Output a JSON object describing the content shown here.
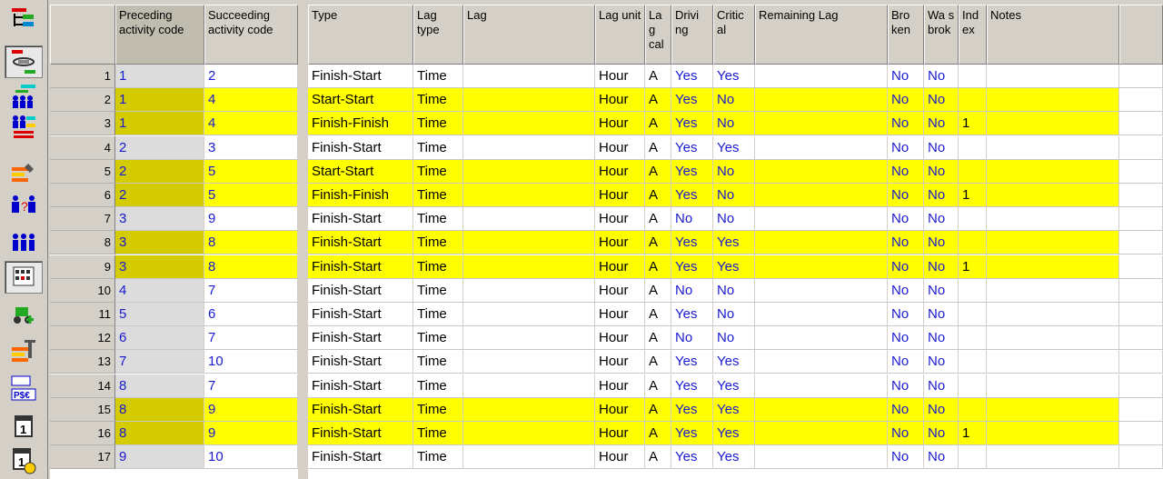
{
  "toolbar": {
    "icons": [
      "gantt-icon",
      "relationship-icon",
      "hierarchy-icon",
      "resource-icon",
      "layers-icon",
      "tool-icon",
      "unknown-resource-icon",
      "people-icon",
      "calendar-grid-icon",
      "tractor-icon",
      "pipe-icon",
      "currency-icon",
      "calendar-day-icon",
      "calendar-clock-icon"
    ]
  },
  "headers": {
    "pred": "Preceding activity code",
    "succ": "Succeeding activity code",
    "type": "Type",
    "lagtype": "Lag type",
    "lag": "Lag",
    "lagunit": "Lag unit",
    "lagcal": "La g cal",
    "driving": "Drivi ng",
    "critical": "Critic al",
    "remlag": "Remaining Lag",
    "broken": "Bro ken",
    "wasbroken": "Wa s brok",
    "index": "Ind ex",
    "notes": "Notes"
  },
  "rows": [
    {
      "n": "1",
      "pred": "1",
      "succ": "2",
      "type": "Finish-Start",
      "lagtype": "Time",
      "unit": "Hour",
      "cal": "A",
      "drv": "Yes",
      "crit": "Yes",
      "brk": "No",
      "was": "No",
      "idx": "",
      "hl": false
    },
    {
      "n": "2",
      "pred": "1",
      "succ": "4",
      "type": "Start-Start",
      "lagtype": "Time",
      "unit": "Hour",
      "cal": "A",
      "drv": "Yes",
      "crit": "No",
      "brk": "No",
      "was": "No",
      "idx": "",
      "hl": true
    },
    {
      "n": "3",
      "pred": "1",
      "succ": "4",
      "type": "Finish-Finish",
      "lagtype": "Time",
      "unit": "Hour",
      "cal": "A",
      "drv": "Yes",
      "crit": "No",
      "brk": "No",
      "was": "No",
      "idx": "1",
      "hl": true
    },
    {
      "n": "4",
      "pred": "2",
      "succ": "3",
      "type": "Finish-Start",
      "lagtype": "Time",
      "unit": "Hour",
      "cal": "A",
      "drv": "Yes",
      "crit": "Yes",
      "brk": "No",
      "was": "No",
      "idx": "",
      "hl": false
    },
    {
      "n": "5",
      "pred": "2",
      "succ": "5",
      "type": "Start-Start",
      "lagtype": "Time",
      "unit": "Hour",
      "cal": "A",
      "drv": "Yes",
      "crit": "No",
      "brk": "No",
      "was": "No",
      "idx": "",
      "hl": true
    },
    {
      "n": "6",
      "pred": "2",
      "succ": "5",
      "type": "Finish-Finish",
      "lagtype": "Time",
      "unit": "Hour",
      "cal": "A",
      "drv": "Yes",
      "crit": "No",
      "brk": "No",
      "was": "No",
      "idx": "1",
      "hl": true
    },
    {
      "n": "7",
      "pred": "3",
      "succ": "9",
      "type": "Finish-Start",
      "lagtype": "Time",
      "unit": "Hour",
      "cal": "A",
      "drv": "No",
      "crit": "No",
      "brk": "No",
      "was": "No",
      "idx": "",
      "hl": false
    },
    {
      "n": "8",
      "pred": "3",
      "succ": "8",
      "type": "Finish-Start",
      "lagtype": "Time",
      "unit": "Hour",
      "cal": "A",
      "drv": "Yes",
      "crit": "Yes",
      "brk": "No",
      "was": "No",
      "idx": "",
      "hl": true
    },
    {
      "n": "9",
      "pred": "3",
      "succ": "8",
      "type": "Finish-Start",
      "lagtype": "Time",
      "unit": "Hour",
      "cal": "A",
      "drv": "Yes",
      "crit": "Yes",
      "brk": "No",
      "was": "No",
      "idx": "1",
      "hl": true
    },
    {
      "n": "10",
      "pred": "4",
      "succ": "7",
      "type": "Finish-Start",
      "lagtype": "Time",
      "unit": "Hour",
      "cal": "A",
      "drv": "No",
      "crit": "No",
      "brk": "No",
      "was": "No",
      "idx": "",
      "hl": false
    },
    {
      "n": "11",
      "pred": "5",
      "succ": "6",
      "type": "Finish-Start",
      "lagtype": "Time",
      "unit": "Hour",
      "cal": "A",
      "drv": "Yes",
      "crit": "No",
      "brk": "No",
      "was": "No",
      "idx": "",
      "hl": false
    },
    {
      "n": "12",
      "pred": "6",
      "succ": "7",
      "type": "Finish-Start",
      "lagtype": "Time",
      "unit": "Hour",
      "cal": "A",
      "drv": "No",
      "crit": "No",
      "brk": "No",
      "was": "No",
      "idx": "",
      "hl": false
    },
    {
      "n": "13",
      "pred": "7",
      "succ": "10",
      "type": "Finish-Start",
      "lagtype": "Time",
      "unit": "Hour",
      "cal": "A",
      "drv": "Yes",
      "crit": "Yes",
      "brk": "No",
      "was": "No",
      "idx": "",
      "hl": false
    },
    {
      "n": "14",
      "pred": "8",
      "succ": "7",
      "type": "Finish-Start",
      "lagtype": "Time",
      "unit": "Hour",
      "cal": "A",
      "drv": "Yes",
      "crit": "Yes",
      "brk": "No",
      "was": "No",
      "idx": "",
      "hl": false
    },
    {
      "n": "15",
      "pred": "8",
      "succ": "9",
      "type": "Finish-Start",
      "lagtype": "Time",
      "unit": "Hour",
      "cal": "A",
      "drv": "Yes",
      "crit": "Yes",
      "brk": "No",
      "was": "No",
      "idx": "",
      "hl": true
    },
    {
      "n": "16",
      "pred": "8",
      "succ": "9",
      "type": "Finish-Start",
      "lagtype": "Time",
      "unit": "Hour",
      "cal": "A",
      "drv": "Yes",
      "crit": "Yes",
      "brk": "No",
      "was": "No",
      "idx": "1",
      "hl": true
    },
    {
      "n": "17",
      "pred": "9",
      "succ": "10",
      "type": "Finish-Start",
      "lagtype": "Time",
      "unit": "Hour",
      "cal": "A",
      "drv": "Yes",
      "crit": "Yes",
      "brk": "No",
      "was": "No",
      "idx": "",
      "hl": false
    }
  ]
}
